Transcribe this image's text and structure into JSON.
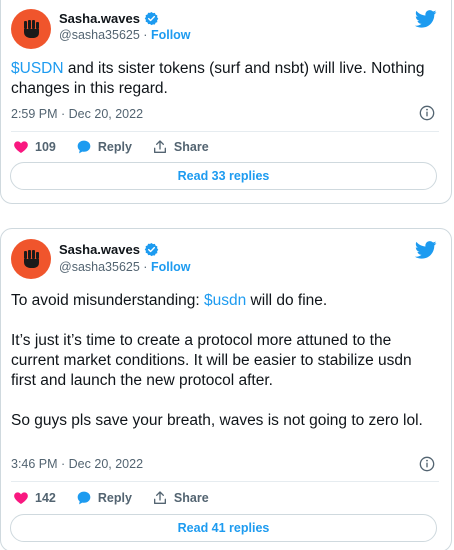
{
  "tweets": [
    {
      "author": {
        "name": "Sasha.waves",
        "handle": "@sasha35625",
        "separator": "·",
        "follow_label": "Follow"
      },
      "text_parts": {
        "cashtag": "$USDN",
        "rest": " and its sister tokens (surf and nsbt) will live. Nothing changes in this regard."
      },
      "timestamp": "2:59 PM · Dec 20, 2022",
      "likes": "109",
      "reply_label": "Reply",
      "share_label": "Share",
      "read_replies_label": "Read 33 replies"
    },
    {
      "author": {
        "name": "Sasha.waves",
        "handle": "@sasha35625",
        "separator": "·",
        "follow_label": "Follow"
      },
      "text_parts": {
        "prefix": "To avoid misunderstanding: ",
        "cashtag": "$usdn",
        "suffix": " will do fine.",
        "para2": "It’s just it’s time to create a protocol more attuned to the current market conditions. It will be easier to stabilize usdn first and launch the new protocol after.",
        "para3": "So guys pls save your breath, waves is not going to zero lol."
      },
      "timestamp": "3:46 PM · Dec 20, 2022",
      "likes": "142",
      "reply_label": "Reply",
      "share_label": "Share",
      "read_replies_label": "Read 41 replies"
    }
  ],
  "colors": {
    "accent": "#1d9bf0",
    "avatar_bg": "#f0552c",
    "heart": "#f91880",
    "muted": "#536471",
    "border": "#cfd9de"
  },
  "icons": [
    "fist-icon",
    "verified-badge-icon",
    "twitter-bird-icon",
    "info-icon",
    "heart-icon",
    "reply-bubble-icon",
    "share-icon"
  ]
}
